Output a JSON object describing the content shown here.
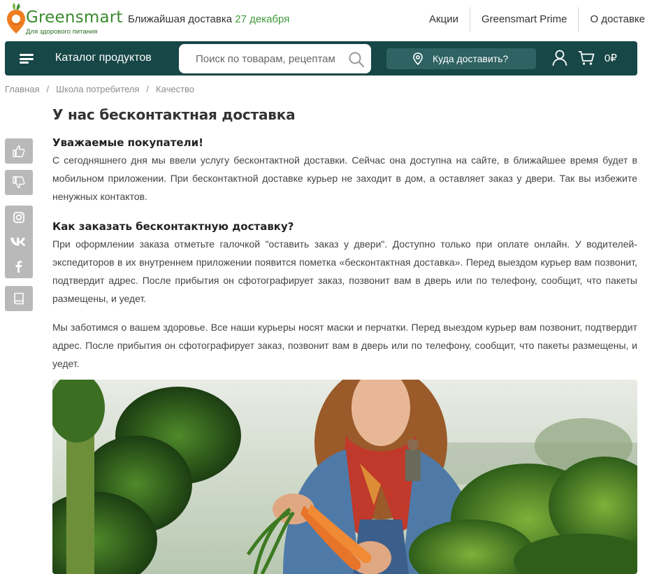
{
  "header": {
    "logo_name": "Greensmart",
    "logo_tagline": "Для здорового питания",
    "delivery_prefix": "Ближайшая доставка",
    "delivery_date": "27 декабря",
    "links": [
      "Акции",
      "Greensmart Prime",
      "О доставке"
    ]
  },
  "navbar": {
    "catalog_label": "Каталог продуктов",
    "search_placeholder": "Поиск по товарам, рецептам",
    "where_label": "Куда доставить?",
    "cart_total": "0₽"
  },
  "breadcrumb": [
    "Главная",
    "Школа потребителя",
    "Качество"
  ],
  "side_buttons": [
    "thumbs-up-icon",
    "thumbs-down-icon",
    "instagram-icon",
    "vk-icon",
    "facebook-icon",
    "bookmark-icon"
  ],
  "article": {
    "title": "У нас бесконтактная доставка",
    "section1_title": "Уважаемые покупатели!",
    "section1_text": "С сегодняшнего дня мы ввели услугу бесконтактной доставки. Сейчас она доступна на сайте, в ближайшее время будет в мобильном приложении. При бесконтактной доставке курьер не заходит в дом, а оставляет заказ у двери. Так вы избежите ненужных контактов.",
    "section2_title": "Как заказать бесконтактную доставку?",
    "section2_text": "При оформлении заказа отметьте галочкой \"оставить заказ у двери\". Доступно только при оплате онлайн. У водителей-экспедиторов в их внутреннем приложении появится пометка «бесконтактная доставка». Перед выездом курьер вам позвонит, подтвердит адрес. После прибытия он сфотографирует заказ, позвонит вам в дверь или по телефону, сообщит, что пакеты размещены, и уедет.",
    "section3_text": "Мы заботимся о вашем здоровье. Все наши курьеры носят маски и перчатки. Перед выездом курьер вам позвонит, подтвердит адрес. После прибытия он сфотографирует заказ, позвонит вам в дверь или по телефону, сообщит, что пакеты размещены, и уедет."
  },
  "colors": {
    "brand_green": "#3a8a2e",
    "nav_bg": "#174747",
    "nav_button": "#2f6262",
    "side_button": "#b9b9b9"
  }
}
